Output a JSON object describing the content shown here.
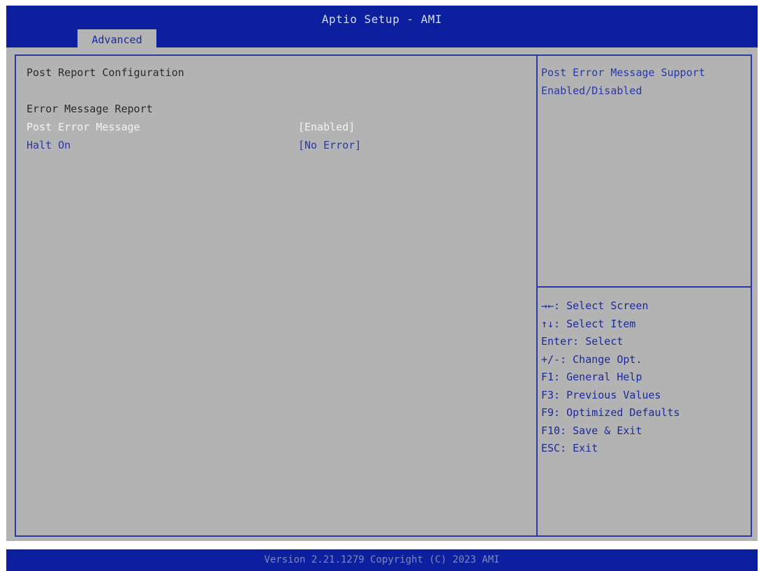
{
  "header": {
    "title": "Aptio Setup - AMI",
    "tabs": [
      {
        "label": "Advanced",
        "active": true
      }
    ]
  },
  "main": {
    "heading": "Post Report Configuration",
    "section_label": "Error Message Report",
    "items": [
      {
        "label": "Post Error Message",
        "value": "[Enabled]",
        "selected": true
      },
      {
        "label": "Halt On",
        "value": "[No Error]",
        "selected": false
      }
    ]
  },
  "help": {
    "line1": "Post Error Message Support",
    "line2": "Enabled/Disabled"
  },
  "keys": [
    "→←: Select Screen",
    "↑↓: Select Item",
    "Enter: Select",
    "+/-: Change Opt.",
    "F1: General Help",
    "F3: Previous Values",
    "F9: Optimized Defaults",
    "F10: Save & Exit",
    "ESC: Exit"
  ],
  "footer": {
    "text": "Version 2.21.1279 Copyright (C) 2023 AMI"
  },
  "colors": {
    "header_bg": "#0c1f9e",
    "panel_bg": "#b3b3b3",
    "border": "#2b3a9c",
    "selected_text": "#f2f2f2",
    "option_text": "#2838a8"
  }
}
